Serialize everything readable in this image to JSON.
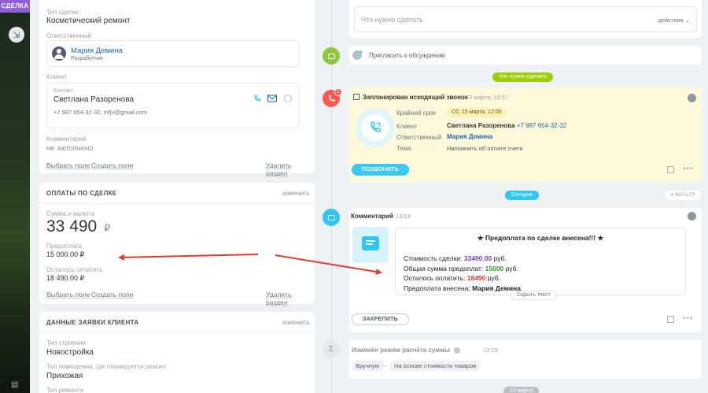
{
  "sidebar": {
    "deal_tag": "СДЕЛКА"
  },
  "deal": {
    "type_label": "Тип сделки",
    "type_value": "Косметический ремонт",
    "responsible_label": "Ответственный",
    "responsible_name": "Мария Демина",
    "responsible_role": "Разработчик",
    "client_label": "Клиент",
    "contact_label": "Контакт",
    "contact_name": "Светлана Разоренова",
    "contact_details": "+7 987 654-32-32, mfjv@gmail.com",
    "comment_label": "Комментарий",
    "comment_value": "не заполнено",
    "select_field": "Выбрать поле",
    "create_field": "Создать поле",
    "delete_section": "Удалить раздел"
  },
  "payments": {
    "title": "ОПЛАТЫ ПО СДЕЛКЕ",
    "edit": "изменить",
    "sum_label": "Сумма и валюта",
    "sum_value": "33 490",
    "currency": "₽",
    "prepay_label": "Предоплата",
    "prepay_value": "15 000.00 ₽",
    "remaining_label": "Осталось оплатить",
    "remaining_value": "18 490.00 ₽",
    "select_field": "Выбрать поле",
    "create_field": "Создать поле",
    "delete_section": "Удалить раздел"
  },
  "client_request": {
    "title": "ДАННЫЕ ЗАЯВКИ КЛИЕНТА",
    "edit": "изменить",
    "building_label": "Тип строения",
    "building_value": "Новостройка",
    "room_label": "Тип помещения, где планируется ремонт",
    "room_value": "Прихожая",
    "repair_label": "Тип ремонта"
  },
  "timeline": {
    "todo_placeholder": "Что нужно сделать",
    "actions_label": "действия",
    "invite_label": "Пригласить к обсуждению",
    "todo_pill": "Что нужно сделать",
    "call": {
      "badge": "1",
      "title": "Запланирован исходящий звонок",
      "time": "15 марта, 15:57",
      "deadline_label": "Крайний срок",
      "deadline_value": "Сб, 15 марта, 12:00",
      "client_label": "Клиент",
      "client_name": "Светлана Разоренова",
      "client_phone": "+7 987 654-32-32",
      "responsible_label": "Ответственный",
      "responsible_value": "Мария Демина",
      "topic_label": "Тема",
      "topic_value": "Напомнить об оплате счета",
      "call_button": "ПОЗВОНИТЬ"
    },
    "today_pill": "Сегодня",
    "filter_label": "ФИЛЬТР",
    "comment": {
      "title": "Комментарий",
      "time": "13:19",
      "heading": "★ Предоплата по сделке внесена!!! ★",
      "line1_label": "Стоимость сделки:",
      "line1_value": "33490.00",
      "line1_unit": "руб.",
      "line2_label": "Общая сумма предоплат:",
      "line2_value": "15000",
      "line2_unit": "руб.",
      "line3_label": "Осталось оплатить:",
      "line3_value": "18490",
      "line3_unit": "руб.",
      "line4_label": "Предоплата внесена:",
      "line4_value": "Мария Демина",
      "hide_text": "Скрыть текст",
      "pin_button": "ЗАКРЕПИТЬ"
    },
    "mode_change": {
      "title": "Изменён режим расчёта суммы",
      "time": "13:19",
      "from": "Вручную",
      "arrow": "→",
      "to": "На основе стоимости товаров"
    },
    "date_pill": "13 марта"
  },
  "colors": {
    "accent": "#3bc8f5",
    "green": "#9dcf00",
    "link": "#2067b0",
    "arrow_red": "#e03a2f",
    "call_red": "#ff5752",
    "todo_bg": "#fef9db"
  }
}
